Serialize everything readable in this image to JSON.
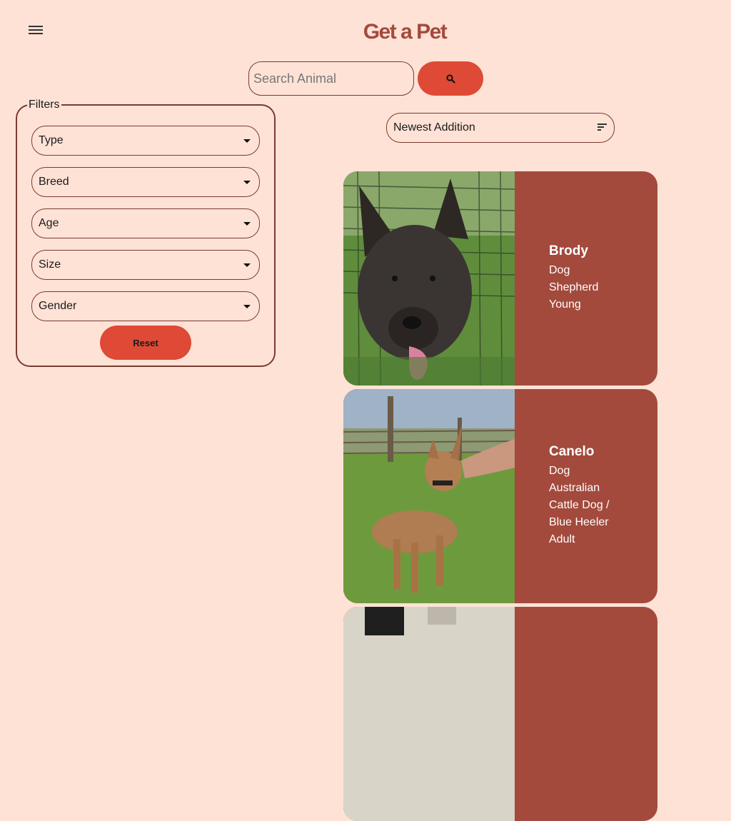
{
  "header": {
    "title": "Get a Pet",
    "menu_icon": "hamburger-menu-icon"
  },
  "search": {
    "placeholder": "Search Animal",
    "value": "",
    "button_icon": "search-icon"
  },
  "filters": {
    "legend": "Filters",
    "selects": [
      {
        "label": "Type"
      },
      {
        "label": "Breed"
      },
      {
        "label": "Age"
      },
      {
        "label": "Size"
      },
      {
        "label": "Gender"
      }
    ],
    "reset_label": "Reset"
  },
  "sort": {
    "selected": "Newest Addition",
    "icon": "sort-icon"
  },
  "pets": [
    {
      "name": "Brody",
      "type": "Dog",
      "breed": "Shepherd",
      "age": "Young"
    },
    {
      "name": "Canelo",
      "type": "Dog",
      "breed": "Australian Cattle Dog / Blue Heeler",
      "age": "Adult"
    }
  ],
  "colors": {
    "background": "#ffe2d6",
    "accent": "#de4a35",
    "card": "#a34a3d",
    "border": "#7a3a30"
  }
}
